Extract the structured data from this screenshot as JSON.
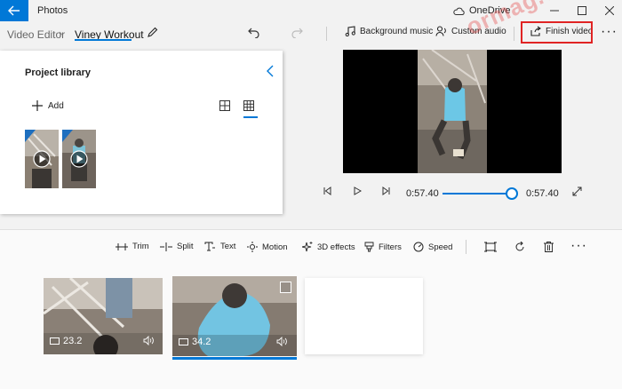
{
  "titlebar": {
    "app_title": "Photos",
    "onedrive": "OneDrive"
  },
  "breadcrumb": {
    "root": "Video Editor",
    "project": "Viney Workout"
  },
  "commands": {
    "background_music": "Background music",
    "custom_audio": "Custom audio",
    "finish_video": "Finish video"
  },
  "library": {
    "title": "Project library",
    "add": "Add"
  },
  "player": {
    "current_time": "0:57.40",
    "total_time": "0:57.40",
    "progress": 1.0
  },
  "tools": {
    "trim": "Trim",
    "split": "Split",
    "text": "Text",
    "motion": "Motion",
    "effects_3d": "3D effects",
    "filters": "Filters",
    "speed": "Speed"
  },
  "clips": [
    {
      "duration": "23.2"
    },
    {
      "duration": "34.2"
    }
  ],
  "watermark": "ormag.com",
  "colors": {
    "accent": "#0078d7",
    "highlight_box": "#e02424"
  }
}
